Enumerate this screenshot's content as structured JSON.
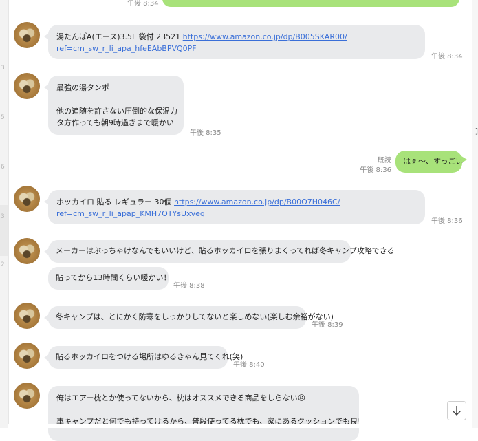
{
  "left_marks": [
    "3",
    "5",
    "6",
    "3",
    "2"
  ],
  "right_glyph": "]",
  "top_partial": {
    "time": "午後 8:34"
  },
  "messages": [
    {
      "id": "m1",
      "lines": [
        "湯たんぽA(エース)3.5L 袋付 23521 "
      ],
      "link_head": "https://www.amazon.co.jp/dp/B005SKAR00/",
      "link_tail": "ref=cm_sw_r_li_apa_hfeEAbBPVQ0PF",
      "time": "午後 8:34"
    },
    {
      "id": "m2",
      "lines": [
        "最強の湯タンポ",
        "",
        "他の追随を許さない圧倒的な保温力",
        "タ方作っても朝9時過ぎまで暖かい"
      ],
      "time": "午後 8:35"
    },
    {
      "id": "m3",
      "outgoing": true,
      "text": "はぇ〜、すっごい",
      "read": "既読",
      "time": "午後 8:36"
    },
    {
      "id": "m4",
      "lines": [
        "ホッカイロ 貼る レギュラー 30個 "
      ],
      "link_head": "https://www.amazon.co.jp/dp/B00O7H046C/",
      "link_tail": "ref=cm_sw_r_li_apap_KMH7OTYsUxveq",
      "time": "午後 8:36"
    },
    {
      "id": "m5",
      "text": "メーカーはぶっちゃけなんでもいいけど、貼るホッカイロを張りまくってれば冬キャンプ攻略できる"
    },
    {
      "id": "m6",
      "text": "貼ってから13時間くらい暖かい！",
      "time": "午後 8:38"
    },
    {
      "id": "m7",
      "text": "冬キャンプは、とにかく防寒をしっかりしてないと楽しめない(楽しむ余裕がない)",
      "time": "午後 8:39"
    },
    {
      "id": "m8",
      "text": "貼るホッカイロをつける場所はゆるきゃん見てくれ(笑)",
      "time": "午後 8:40"
    },
    {
      "id": "m9",
      "lines": [
        "俺はエアー枕とか使ってないから、枕はオススメできる商品をしらない",
        "",
        "車キャンプだと何でも持ってけるから、普段使ってる枕でも、家にあるクッションでも良いと思う。"
      ],
      "emoji": "😣"
    }
  ],
  "scroll_button": {
    "icon": "arrow-down-icon"
  },
  "colors": {
    "incoming_bubble": "#e9eaec",
    "outgoing_bubble": "#a8e27a",
    "link": "#3a6fd8",
    "timestamp": "#8a8a8a"
  }
}
